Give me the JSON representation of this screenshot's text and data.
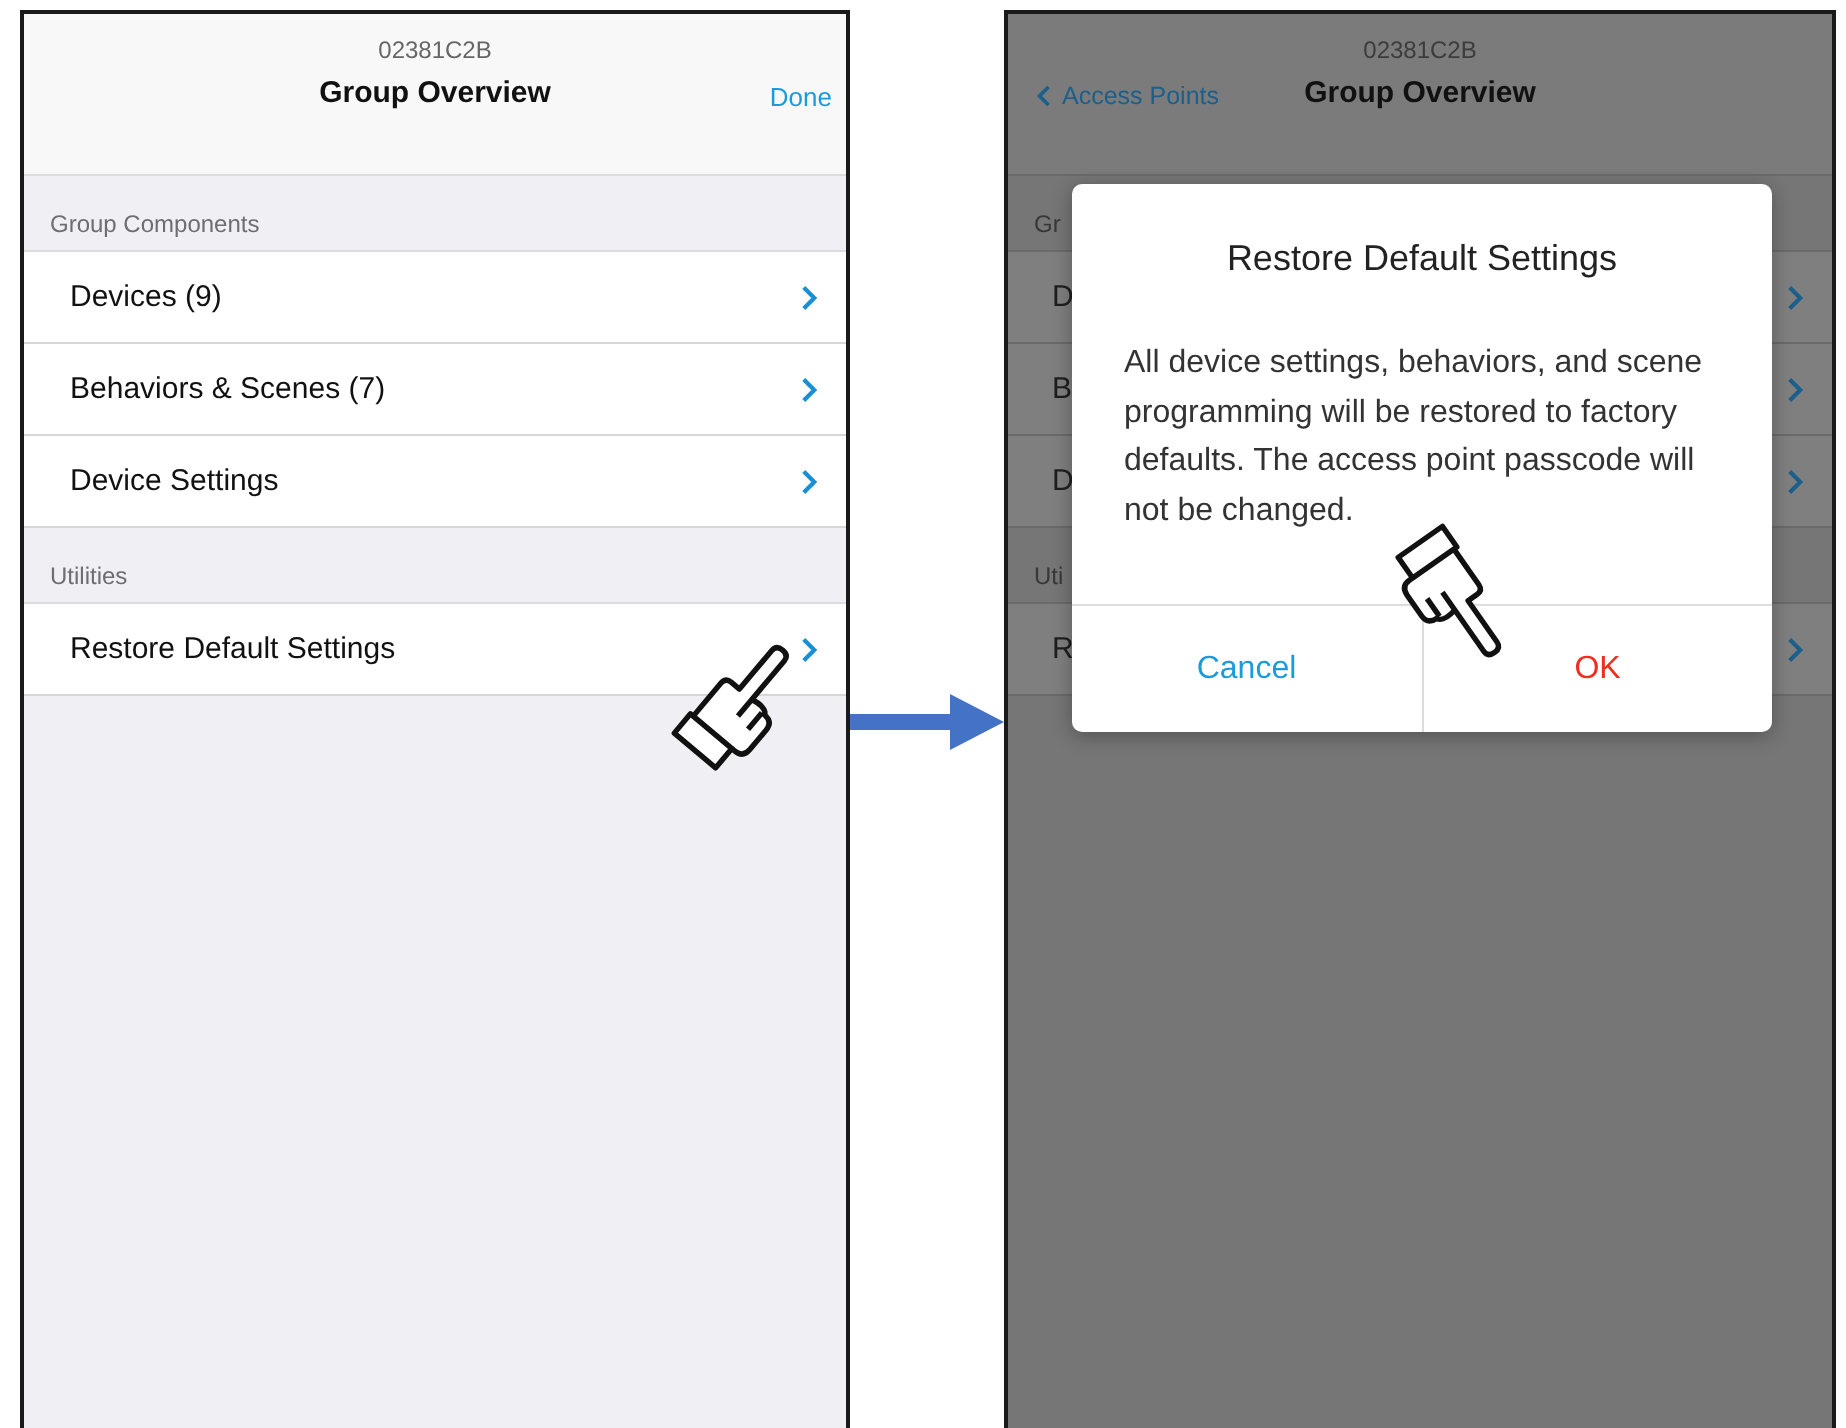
{
  "left_screen": {
    "subtitle": "02381C2B",
    "title": "Group Overview",
    "done_button": "Done",
    "sections": [
      {
        "header": "Group Components",
        "rows": [
          {
            "label": "Devices (9)"
          },
          {
            "label": "Behaviors & Scenes (7)"
          },
          {
            "label": "Device Settings"
          }
        ]
      },
      {
        "header": "Utilities",
        "rows": [
          {
            "label": "Restore Default Settings"
          }
        ]
      }
    ]
  },
  "right_screen": {
    "subtitle": "02381C2B",
    "back_button": "Access Points",
    "title": "Group Overview",
    "sections": [
      {
        "header": "Gr",
        "rows": [
          {
            "label": "D"
          },
          {
            "label": "B"
          },
          {
            "label": "D"
          }
        ]
      },
      {
        "header": "Uti",
        "rows": [
          {
            "label": "R"
          }
        ]
      }
    ],
    "dialog": {
      "title": "Restore Default Settings",
      "message": "All device settings, behaviors, and scene programming will be restored to factory defaults. The access point passcode will not be changed.",
      "buttons": [
        {
          "label": "Cancel",
          "kind": "cancel"
        },
        {
          "label": "OK",
          "kind": "destructive"
        }
      ]
    }
  }
}
